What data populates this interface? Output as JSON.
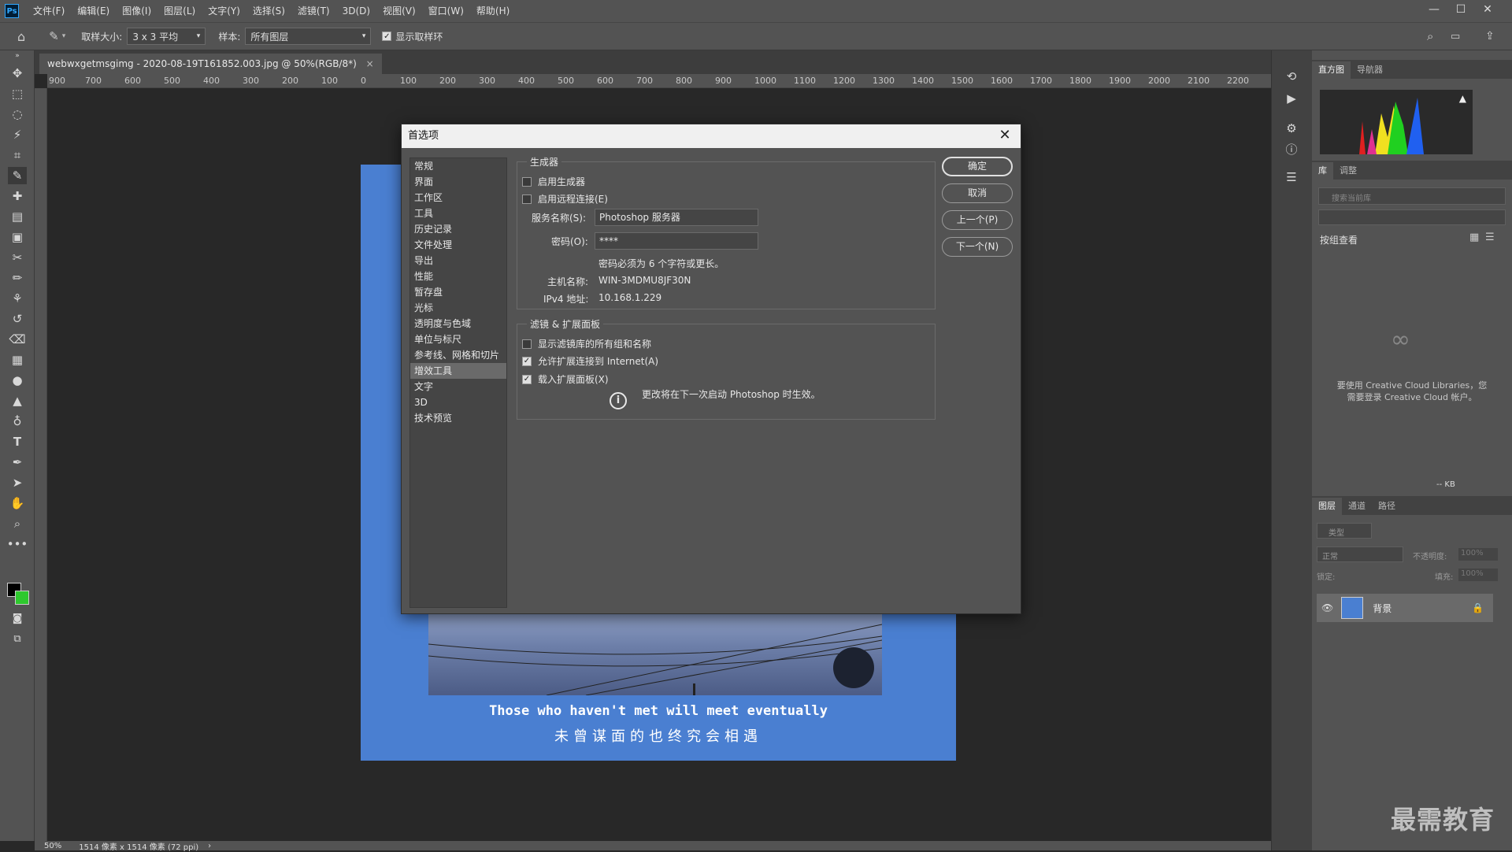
{
  "app": {
    "logo": "Ps"
  },
  "menu": [
    "文件(F)",
    "编辑(E)",
    "图像(I)",
    "图层(L)",
    "文字(Y)",
    "选择(S)",
    "滤镜(T)",
    "3D(D)",
    "视图(V)",
    "窗口(W)",
    "帮助(H)"
  ],
  "options": {
    "sample_size_label": "取样大小:",
    "sample_size_value": "3 x 3 平均",
    "sample_label": "样本:",
    "sample_value": "所有图层",
    "show_ring_label": "显示取样环",
    "show_ring_checked": true
  },
  "document": {
    "tab_title": "webwxgetmsgimg - 2020-08-19T161852.003.jpg @ 50%(RGB/8*)",
    "tab_close": "×",
    "ruler_ticks": [
      "900",
      "700",
      "600",
      "500",
      "400",
      "300",
      "200",
      "100",
      "0",
      "100",
      "200",
      "300",
      "400",
      "500",
      "600",
      "700",
      "800",
      "900",
      "1000",
      "1100",
      "1200",
      "1300",
      "1400",
      "1500",
      "1600",
      "1700",
      "1800",
      "1900",
      "2000",
      "2100",
      "2200"
    ],
    "caption_en": "Those who haven't met will meet eventually",
    "caption_cn": "未曾谋面的也终究会相遇",
    "image_color": "#4a7fd1"
  },
  "status": {
    "zoom": "50%",
    "dimensions": "1514 像素 x 1514 像素 (72 ppi)",
    "arrow": "›"
  },
  "panels": {
    "top_tabs": [
      "直方图",
      "导航器"
    ],
    "lib_tabs": [
      "库",
      "调整"
    ],
    "lib_search_placeholder": "搜索当前库",
    "lib_view_label": "按组查看",
    "lib_message_1": "要使用 Creative Cloud Libraries，您",
    "lib_message_2": "需要登录 Creative Cloud 帐户。",
    "lib_size": "-- KB",
    "layer_tabs": [
      "图层",
      "通道",
      "路径"
    ],
    "layer_filter": "类型",
    "blend_mode": "正常",
    "opacity_label": "不透明度:",
    "opacity_value": "100%",
    "lock_label": "锁定:",
    "fill_label": "填充:",
    "fill_value": "100%",
    "layer_name": "背景"
  },
  "dialog": {
    "title": "首选项",
    "categories": [
      "常规",
      "界面",
      "工作区",
      "工具",
      "历史记录",
      "文件处理",
      "导出",
      "性能",
      "暂存盘",
      "光标",
      "透明度与色域",
      "单位与标尺",
      "参考线、网格和切片",
      "增效工具",
      "文字",
      "3D",
      "技术预览"
    ],
    "selected_category": "增效工具",
    "generator": {
      "title": "生成器",
      "enable_generator": "启用生成器",
      "enable_generator_checked": false,
      "enable_remote": "启用远程连接(E)",
      "enable_remote_checked": false,
      "service_name_label": "服务名称(S):",
      "service_name_value": "Photoshop 服务器",
      "password_label": "密码(O):",
      "password_value": "****",
      "password_hint": "密码必须为 6 个字符或更长。",
      "host_label": "主机名称:",
      "host_value": "WIN-3MDMU8JF30N",
      "ipv4_label": "IPv4 地址:",
      "ipv4_value": "10.168.1.229"
    },
    "filters": {
      "title": "滤镜 & 扩展面板",
      "show_all_groups": "显示滤镜库的所有组和名称",
      "show_all_groups_checked": false,
      "allow_internet": "允许扩展连接到 Internet(A)",
      "allow_internet_checked": true,
      "load_panels": "载入扩展面板(X)",
      "load_panels_checked": true,
      "restart_note": "更改将在下一次启动 Photoshop 时生效。"
    },
    "buttons": {
      "ok": "确定",
      "cancel": "取消",
      "prev": "上一个(P)",
      "next": "下一个(N)"
    },
    "close": "✕"
  },
  "watermark": "最需教育"
}
